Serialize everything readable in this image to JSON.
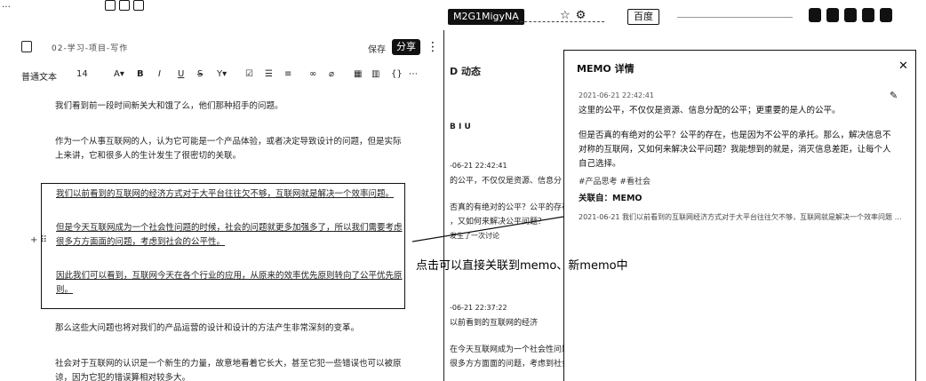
{
  "topbar": {
    "left_title": "…",
    "active_tab": "M2G1MigyNA",
    "browser_label": "百度"
  },
  "editor": {
    "doc_title": "02-学习-项目-写作",
    "status": "保存",
    "share_label": "分享",
    "toolbar": {
      "text_style": "普通文本",
      "font_size": "14",
      "bold": "B",
      "italic": "I",
      "underline": "U",
      "strike": "S",
      "more": "⋯"
    },
    "paragraphs": [
      "我们看到前一段时间新关大和饿了么，他们那种招手的问题。",
      "作为一个从事互联网的人，认为它可能是一个产品体验，或者决定导致设计的问题，但是实际上来讲，它和很多人的生计发生了很密切的关联。",
      "那么这些大问题也将对我们的产品运营的设计和设计的方法产生非常深刻的变革。",
      "社会对于互联网的认识是一个新生的力量，故意地看着它长大，甚至它犯一些错误也可以被原谅，因为它犯的错误算相对较多大。"
    ],
    "highlight": [
      "我们以前看到的互联网的经济方式对于大平台往往欠不够，互联网就是解决一个效率问题。",
      "但是今天互联网成为一个社会性问题的时候，社会的问题就更多加强多了，所以我们需要考虑很多方方面面的问题，考虑到社会的公平性。",
      "因此我们可以看到，互联网今天在各个行业的应用，从原来的效率优先原则转向了公平优先原则。"
    ]
  },
  "middle": {
    "lines": [
      "D 动态",
      "B I U",
      "-06-21 22:42:41",
      "的公平，不仅仅是资源、信息分",
      "否真的有绝对的公平？公平的存在",
      "，又如何来解决公平问题？",
      "发生了一次讨论",
      "-06-21 22:37:22",
      "以前看到的互联网的经济",
      "在今天互联网成为一个社会性问题",
      "很多方方面面的问题，考虑到社会"
    ]
  },
  "memo": {
    "title": "MEMO 详情",
    "time": "2021-06-21 22:42:41",
    "text1": "这里的公平，不仅仅是资源、信息分配的公平；更重要的是人的公平。",
    "text2": "但是否真的有绝对的公平？公平的存在，也是因为不公平的承托。那么，解决信息不对称的互联网，又如何来解决公平问题？我能想到的就是，消灭信息差距，让每个人自己选择。",
    "tags": "#产品思考  #看社会",
    "assoc": "关联自：MEMO",
    "ref": "2021-06-21 我们以前看到的互联网经济方式对于大平台往往欠不够，互联网就是解决一个效率问题 …"
  },
  "annotation": "点击可以直接关联到memo、新memo中"
}
